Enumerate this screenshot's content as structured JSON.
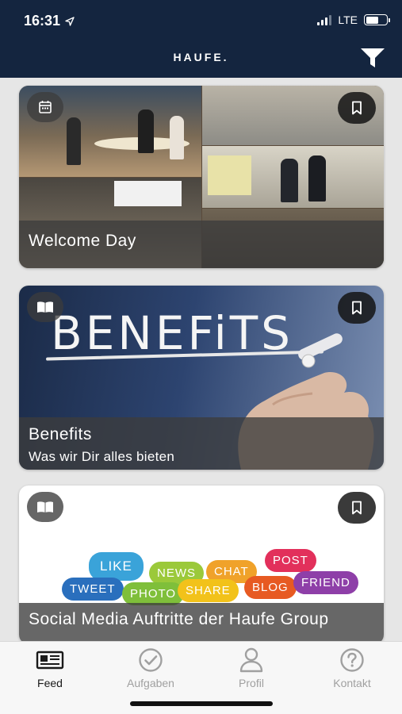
{
  "status": {
    "time": "16:31",
    "network": "LTE"
  },
  "header": {
    "logo": "HAUFE."
  },
  "cards": [
    {
      "title": "Welcome Day",
      "type_icon": "calendar-icon",
      "bookmark_icon": "bookmark-icon"
    },
    {
      "title": "Benefits",
      "subtitle": "Was wir Dir alles bieten",
      "image_text": "BENEFiTS",
      "type_icon": "book-icon",
      "bookmark_icon": "bookmark-icon"
    },
    {
      "title": "Social Media Auftritte der Haufe Group",
      "type_icon": "book-icon",
      "bookmark_icon": "bookmark-icon",
      "bubbles": [
        "LIKE",
        "NEWS",
        "CHAT",
        "POST",
        "TWEET",
        "PHOTO",
        "SHARE",
        "BLOG",
        "FRIEND"
      ]
    }
  ],
  "tabs": [
    {
      "label": "Feed",
      "icon": "newspaper-icon",
      "active": true
    },
    {
      "label": "Aufgaben",
      "icon": "checkmark-circle-icon",
      "active": false
    },
    {
      "label": "Profil",
      "icon": "person-icon",
      "active": false
    },
    {
      "label": "Kontakt",
      "icon": "question-circle-icon",
      "active": false
    }
  ],
  "colors": {
    "header_bg": "#14253f",
    "tab_active": "#1a1a1a",
    "tab_inactive": "#a0a0a0"
  }
}
